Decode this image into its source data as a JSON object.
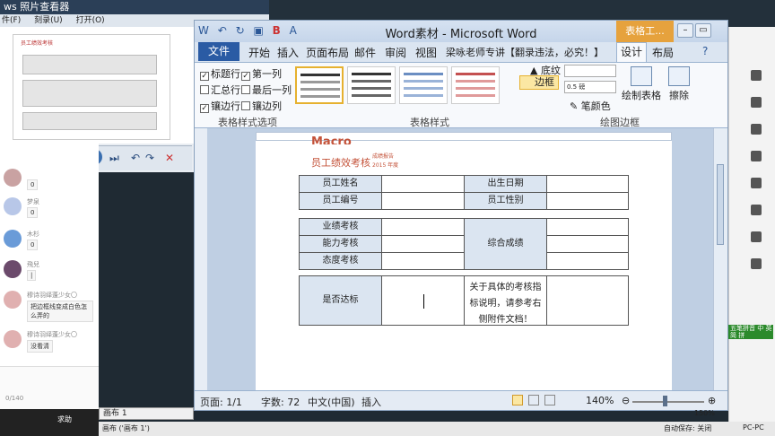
{
  "photo_viewer": {
    "title": "ws 照片查看器",
    "menu": [
      "件(F)",
      "刻录(U)",
      "打开(O)"
    ],
    "thumb_title": "员工绩效考核",
    "thumb_sub": "成绩报告\n2015 年度",
    "thumb_bottom": "是否达标"
  },
  "chat": {
    "items": [
      {
        "name": "",
        "msg": "0"
      },
      {
        "name": "梦泉",
        "msg": "0"
      },
      {
        "name": "木杉",
        "msg": "0"
      },
      {
        "name": "飛兒",
        "msg": "|"
      },
      {
        "name": "穆诗羽绎蓬少女〇",
        "msg": "把边框线变成白色怎么弄的"
      },
      {
        "name": "穆诗羽绎蓬少女〇",
        "msg": "没看清"
      }
    ],
    "counter": "0/140",
    "send_label": "求助"
  },
  "word": {
    "title": "Word素材 - Microsoft Word",
    "context_tab": "表格工...",
    "tabs": [
      "开始",
      "插入",
      "页面布局",
      "邮件",
      "审阅",
      "视图",
      "梁咏老师专讲【翻录违法，必究！】"
    ],
    "file_tab": "文件",
    "design_tab": "设计",
    "layout_tab": "布局",
    "options": {
      "header_row": "标题行",
      "first_col": "第一列",
      "total_row": "汇总行",
      "last_col": "最后一列",
      "banded_rows": "镶边行",
      "banded_cols": "镶边列"
    },
    "group_style_options": "表格样式选项",
    "group_styles": "表格样式",
    "group_draw": "绘图边框",
    "shading": "底纹",
    "borders": "边框",
    "pen_weight": "0.5 磅",
    "pen_color": "笔颜色",
    "draw_table": "绘制表格",
    "eraser": "擦除",
    "doc": {
      "header_partial": "Macro",
      "heading": "员工绩效考核",
      "heading_sub1": "成绩报告",
      "heading_sub2": "2015 年度",
      "labels": {
        "name": "员工姓名",
        "id": "员工编号",
        "birth": "出生日期",
        "gender": "员工性别",
        "perf": "业绩考核",
        "ability": "能力考核",
        "attitude": "态度考核",
        "overall": "综合成绩",
        "pass": "是否达标",
        "note": "关于具体的考核指标说明，请参考右侧附件文档！"
      }
    },
    "status": {
      "page": "页面: 1/1",
      "words": "字数: 72",
      "lang": "中文(中国)",
      "mode": "插入",
      "zoom": "140%"
    }
  },
  "bottom": {
    "canvas_tab": "画布 1",
    "canvas_status": "画布 ('画布 1')",
    "autosave": "自动保存: 关闭",
    "zoom": "150%",
    "ime": "PC-PC"
  },
  "right_panel": {
    "badge": "五笔拼音 中 英 简 拼"
  }
}
